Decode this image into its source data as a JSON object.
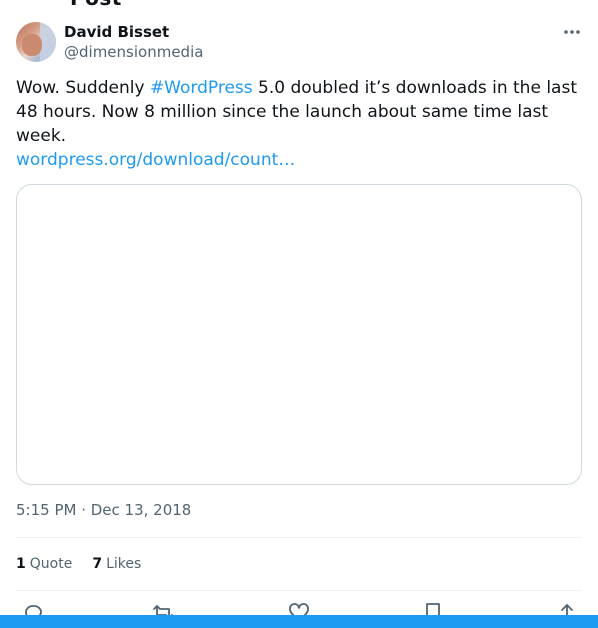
{
  "header": {
    "title": "Post"
  },
  "author": {
    "display_name": "David Bisset",
    "handle": "@dimensionmedia"
  },
  "tweet": {
    "text_before": "Wow. Suddenly ",
    "hashtag": "#WordPress",
    "text_after": " 5.0 doubled it’s downloads in the last 48 hours. Now 8 million since the launch about same time last week.",
    "link": "wordpress.org/download/count…",
    "timestamp": "5:15 PM · Dec 13, 2018"
  },
  "stats": {
    "quotes_count": "1",
    "quotes_label": "Quote",
    "likes_count": "7",
    "likes_label": "Likes"
  },
  "icons": {
    "more": "more-dots-icon",
    "reply": "reply-icon",
    "repost": "repost-icon",
    "like": "like-icon",
    "bookmark": "bookmark-icon",
    "share": "share-icon"
  },
  "colors": {
    "accent": "#1d9bf0",
    "text": "#0f1419",
    "secondary_text": "#536471",
    "border": "#cfd9de"
  }
}
